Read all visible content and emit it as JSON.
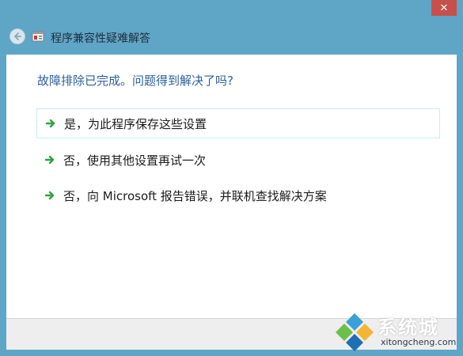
{
  "window": {
    "title": "程序兼容性疑难解答",
    "close_glyph": "✕"
  },
  "main": {
    "question": "故障排除已完成。问题得到解决了吗?",
    "options": [
      {
        "label": "是，为此程序保存这些设置"
      },
      {
        "label": "否，使用其他设置再试一次"
      },
      {
        "label": "否，向 Microsoft 报告错误，并联机查找解决方案"
      }
    ]
  },
  "watermark": {
    "brand": "系统城",
    "url": "xitongcheng.com"
  },
  "colors": {
    "frame": "#5fa5c6",
    "close": "#c7504b",
    "question_text": "#2c5f9e",
    "arrow": "#2fa43c"
  }
}
